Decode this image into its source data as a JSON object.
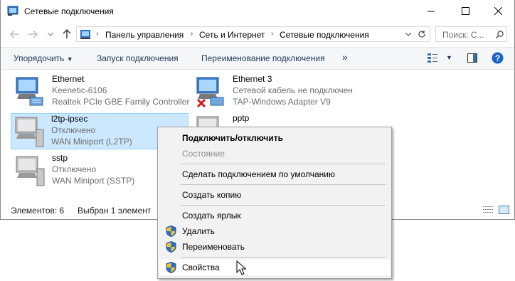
{
  "window": {
    "title": "Сетевые подключения"
  },
  "address": {
    "crumbs": [
      "Панель управления",
      "Сеть и Интернет",
      "Сетевые подключения"
    ],
    "search_placeholder": "Поиск: С..."
  },
  "toolbar": {
    "organize": "Упорядочить",
    "start_connection": "Запуск подключения",
    "rename": "Переименование подключения",
    "more": "»"
  },
  "items": [
    {
      "name": "Ethernet",
      "status": "Keenetic-6106",
      "device": "Realtek PCIe GBE Family Controller"
    },
    {
      "name": "Ethernet 3",
      "status": "Сетевой кабель не подключен",
      "device": "TAP-Windows Adapter V9"
    },
    {
      "name": "l2tp-ipsec",
      "status": "Отключено",
      "device": "WAN Miniport (L2TP)"
    },
    {
      "name": "pptp",
      "status": "",
      "device": ""
    },
    {
      "name": "sstp",
      "status": "Отключено",
      "device": "WAN Miniport (SSTP)"
    }
  ],
  "statusbar": {
    "count": "Элементов: 6",
    "selected": "Выбран 1 элемент"
  },
  "context_menu": {
    "connect": "Подключить/отключить",
    "status": "Состояние",
    "set_default": "Сделать подключением по умолчанию",
    "copy": "Создать копию",
    "shortcut": "Создать ярлык",
    "delete": "Удалить",
    "rename": "Переименовать",
    "properties": "Свойства"
  },
  "colors": {
    "accent": "#1e395b",
    "selection": "#cce8ff",
    "help": "#1a62c7"
  }
}
